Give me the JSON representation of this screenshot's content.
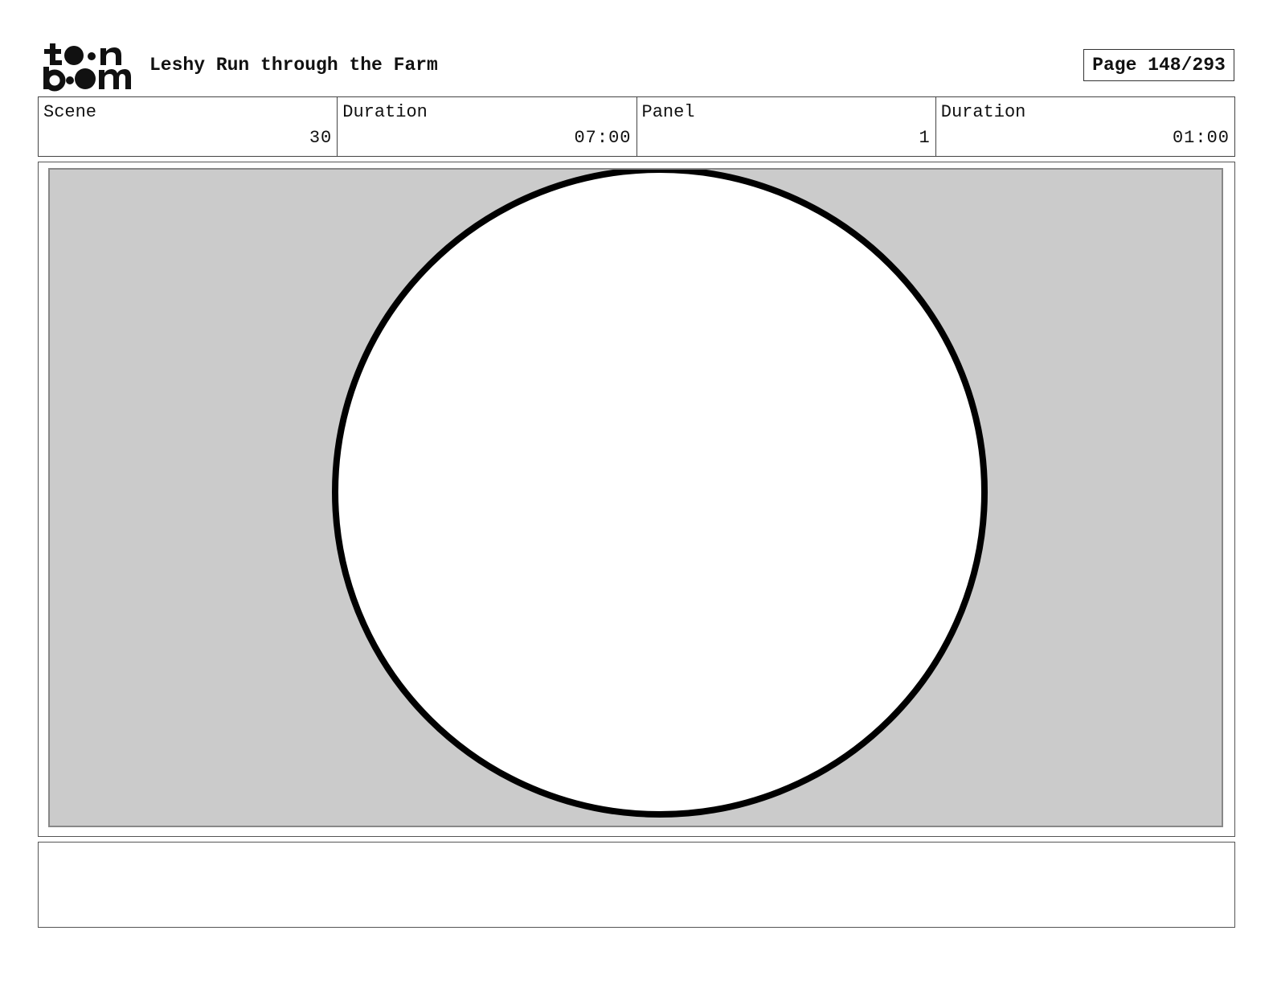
{
  "header": {
    "logo_text": "toonboom",
    "project_title": "Leshy Run through the Farm",
    "page_label": "Page 148/293"
  },
  "info": {
    "scene_label": "Scene",
    "scene_value": "30",
    "scene_duration_label": "Duration",
    "scene_duration_value": "07:00",
    "panel_label": "Panel",
    "panel_value": "1",
    "panel_duration_label": "Duration",
    "panel_duration_value": "01:00"
  },
  "panel": {
    "background_color": "#cbcbcb",
    "circle_fill": "#ffffff",
    "circle_stroke": "#000000"
  },
  "notes": {
    "text": ""
  }
}
